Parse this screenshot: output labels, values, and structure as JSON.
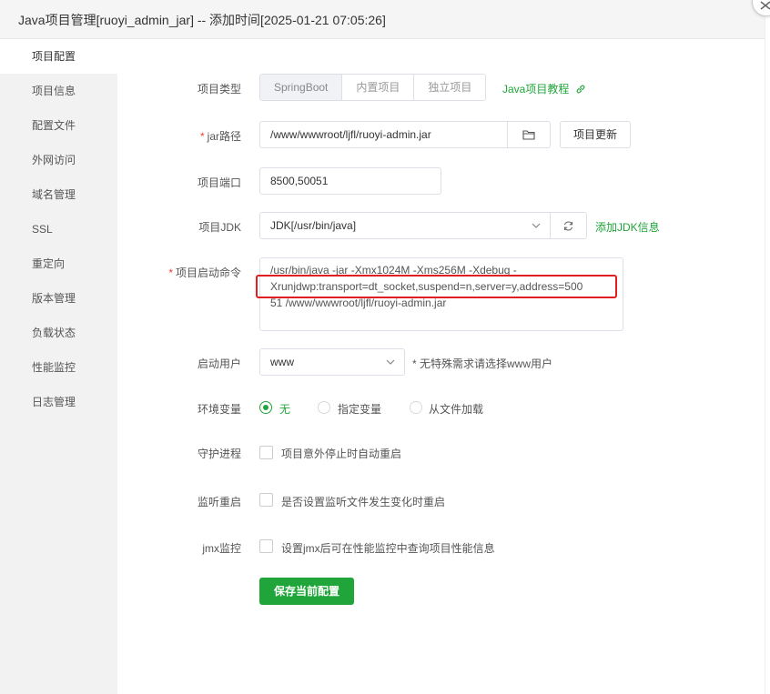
{
  "window": {
    "title": "Java项目管理[ruoyi_admin_jar] -- 添加时间[2025-01-21 07:05:26]"
  },
  "sidebar": {
    "items": [
      {
        "label": "项目配置"
      },
      {
        "label": "项目信息"
      },
      {
        "label": "配置文件"
      },
      {
        "label": "外网访问"
      },
      {
        "label": "域名管理"
      },
      {
        "label": "SSL"
      },
      {
        "label": "重定向"
      },
      {
        "label": "版本管理"
      },
      {
        "label": "负载状态"
      },
      {
        "label": "性能监控"
      },
      {
        "label": "日志管理"
      }
    ],
    "active_index": 0
  },
  "form": {
    "project_type": {
      "label": "项目类型",
      "options": [
        "SpringBoot",
        "内置项目",
        "独立项目"
      ],
      "selected": "SpringBoot",
      "tutorial_link": "Java项目教程"
    },
    "jar_path": {
      "required_mark": "*",
      "label": "jar路径",
      "value": "/www/wwwroot/ljfl/ruoyi-admin.jar",
      "update_button": "项目更新"
    },
    "port": {
      "label": "项目端口",
      "value": "8500,50051"
    },
    "jdk": {
      "label": "项目JDK",
      "value": "JDK[/usr/bin/java]",
      "add_link": "添加JDK信息"
    },
    "start_command": {
      "required_mark": "*",
      "label": "项目启动命令",
      "lines": [
        "/usr/bin/java -jar  -Xmx1024M -Xms256M -Xdebug -",
        "Xrunjdwp:transport=dt_socket,suspend=n,server=y,address=500",
        "51 /www/wwwroot/ljfl/ruoyi-admin.jar"
      ]
    },
    "user": {
      "label": "启动用户",
      "value": "www",
      "hint": "* 无特殊需求请选择www用户"
    },
    "env": {
      "label": "环境变量",
      "options": [
        "无",
        "指定变量",
        "从文件加载"
      ],
      "selected_index": 0
    },
    "daemon": {
      "label": "守护进程",
      "checkbox_label": "项目意外停止时自动重启",
      "checked": false
    },
    "watch_restart": {
      "label": "监听重启",
      "checkbox_label": "是否设置监听文件发生变化时重启",
      "checked": false
    },
    "jmx": {
      "label": "jmx监控",
      "checkbox_label": "设置jmx后可在性能监控中查询项目性能信息",
      "checked": false
    },
    "save_button": "保存当前配置"
  },
  "colors": {
    "accent": "#20a53a",
    "highlight_box": "#e02020",
    "required": "#f04134"
  }
}
